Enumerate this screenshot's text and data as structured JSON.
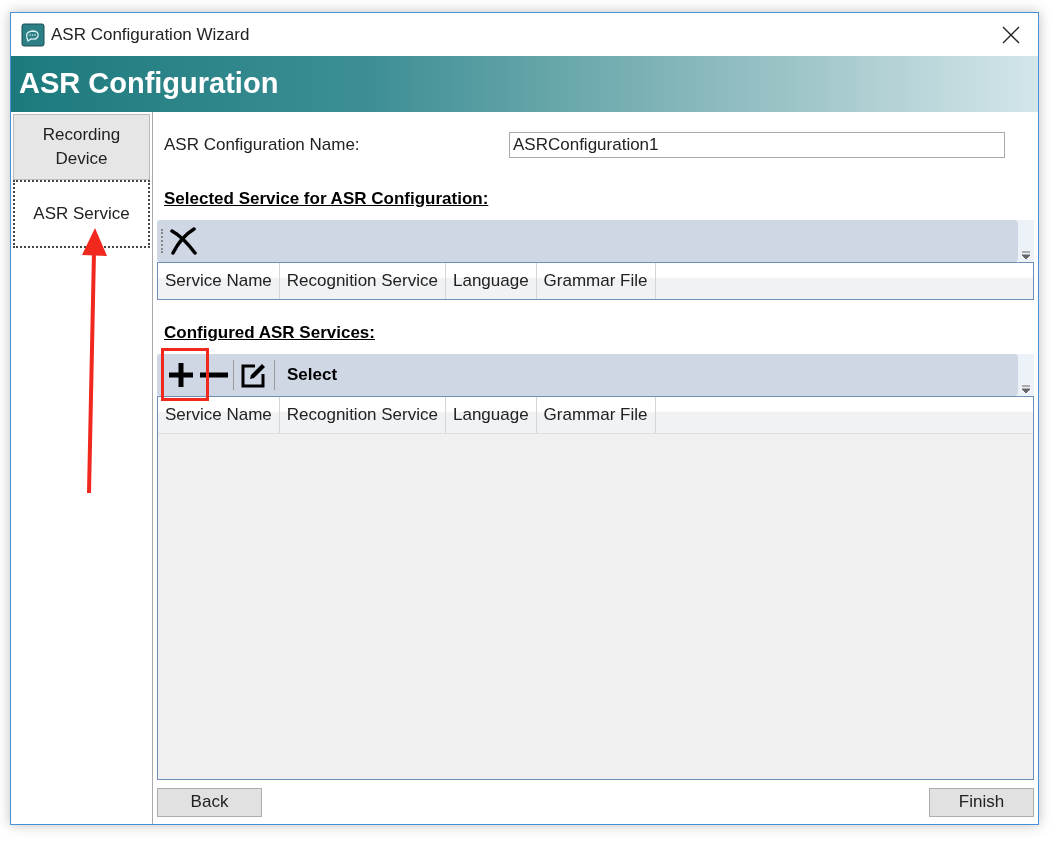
{
  "window": {
    "title": "ASR Configuration Wizard"
  },
  "header": {
    "title": "ASR Configuration"
  },
  "nav": [
    {
      "label": "Recording Device",
      "selected": false
    },
    {
      "label": "ASR Service",
      "selected": true
    }
  ],
  "name_field": {
    "label": "ASR Configuration Name:",
    "value": "ASRConfiguration1"
  },
  "selected_section": {
    "heading": "Selected Service for ASR Configuration:",
    "columns": [
      "Service Name",
      "Recognition Service",
      "Language",
      "Grammar File"
    ]
  },
  "configured_section": {
    "heading": "Configured ASR Services:",
    "toolbar_text": "Select",
    "columns": [
      "Service Name",
      "Recognition Service",
      "Language",
      "Grammar File"
    ]
  },
  "buttons": {
    "back": "Back",
    "finish": "Finish"
  }
}
